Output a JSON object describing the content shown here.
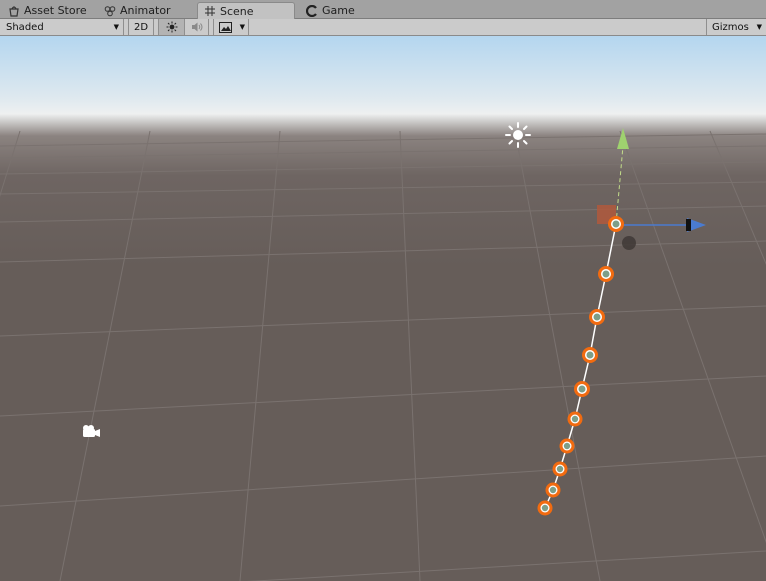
{
  "tabs": [
    {
      "label": "Asset Store",
      "icon": "asset-store-icon",
      "active": false
    },
    {
      "label": "Animator",
      "icon": "animator-icon",
      "active": false
    },
    {
      "label": "Scene",
      "icon": "scene-grid-icon",
      "active": true
    },
    {
      "label": "Game",
      "icon": "game-icon",
      "active": false
    }
  ],
  "toolbar": {
    "shading_mode": "Shaded",
    "mode_2d": "2D",
    "lighting_icon": "sun-icon",
    "audio_icon": "speaker-icon",
    "effects_icon": "image-icon",
    "gizmos_label": "Gizmos"
  },
  "scene": {
    "sky_color": "#b4d6ef",
    "ground_color": "#665d59",
    "light_icon": "directional-light-icon",
    "camera_icon": "camera-icon",
    "chain_link_count": 10,
    "selection_color": "#f26b10",
    "y_axis_color": "#9fd26f",
    "x_axis_color": "#4a7bd0"
  }
}
